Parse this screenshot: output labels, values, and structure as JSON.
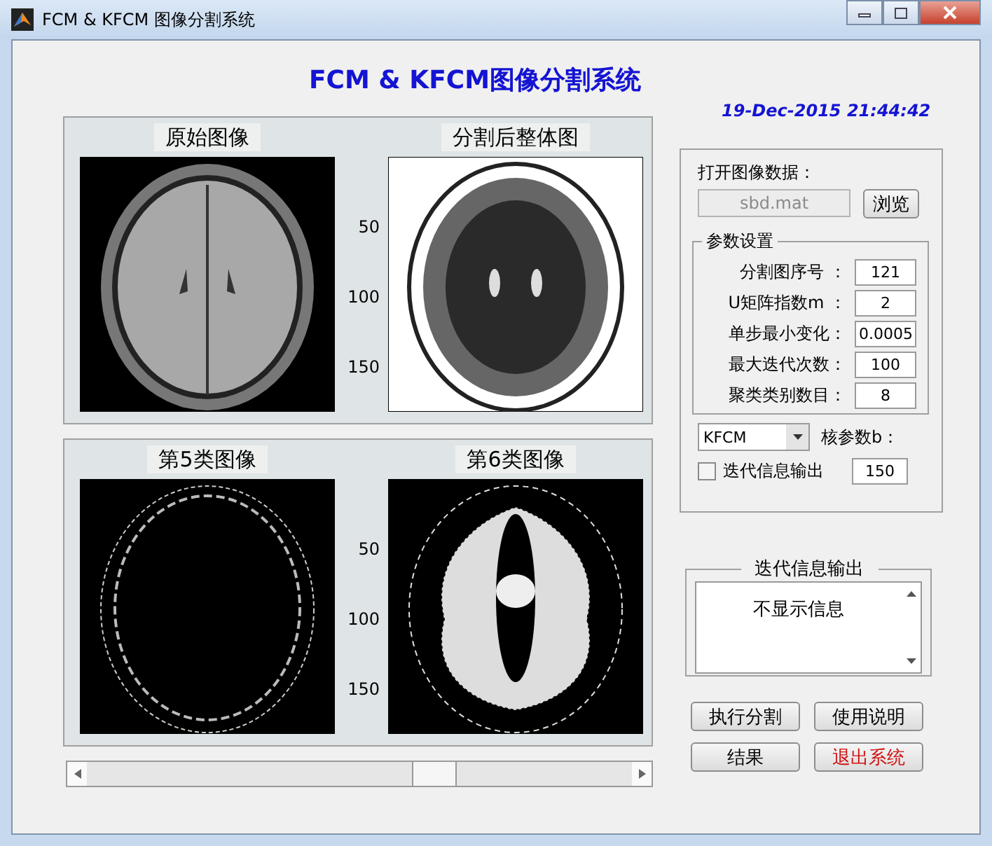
{
  "window": {
    "title": "FCM & KFCM 图像分割系统"
  },
  "header": {
    "title": "FCM & KFCM图像分割系统",
    "timestamp": "19-Dec-2015 21:44:42"
  },
  "plots": [
    {
      "title": "原始图像",
      "kind": "original"
    },
    {
      "title": "分割后整体图",
      "kind": "segmented",
      "yticks": [
        "50",
        "100",
        "150"
      ]
    },
    {
      "title": "第5类图像",
      "kind": "ring"
    },
    {
      "title": "第6类图像",
      "kind": "matter",
      "yticks": [
        "50",
        "100",
        "150"
      ]
    }
  ],
  "slider": {
    "level": 0.65
  },
  "data_file": {
    "label": "打开图像数据：",
    "value": "sbd.mat",
    "disabled": true,
    "browse_button": "浏览"
  },
  "parameters": {
    "title": "参数设置",
    "fields": [
      {
        "label": "分割图序号 ：",
        "value": "121"
      },
      {
        "label": "U矩阵指数m ：",
        "value": "2"
      },
      {
        "label": "单步最小变化：",
        "value": "0.0005"
      },
      {
        "label": "最大迭代次数：",
        "value": "100"
      },
      {
        "label": "聚类类别数目：",
        "value": "8"
      }
    ]
  },
  "algorithm": {
    "value": "KFCM"
  },
  "kernel": {
    "label": "核参数b：",
    "value": "150"
  },
  "verbose": {
    "label": "迭代信息输出",
    "checked": false
  },
  "output": {
    "title": "迭代信息输出",
    "message": "不显示信息"
  },
  "buttons": [
    {
      "label": "执行分割",
      "kind": "normal"
    },
    {
      "label": "使用说明",
      "kind": "normal"
    },
    {
      "label": "结果",
      "kind": "normal"
    },
    {
      "label": "退出系统",
      "kind": "exit"
    }
  ]
}
